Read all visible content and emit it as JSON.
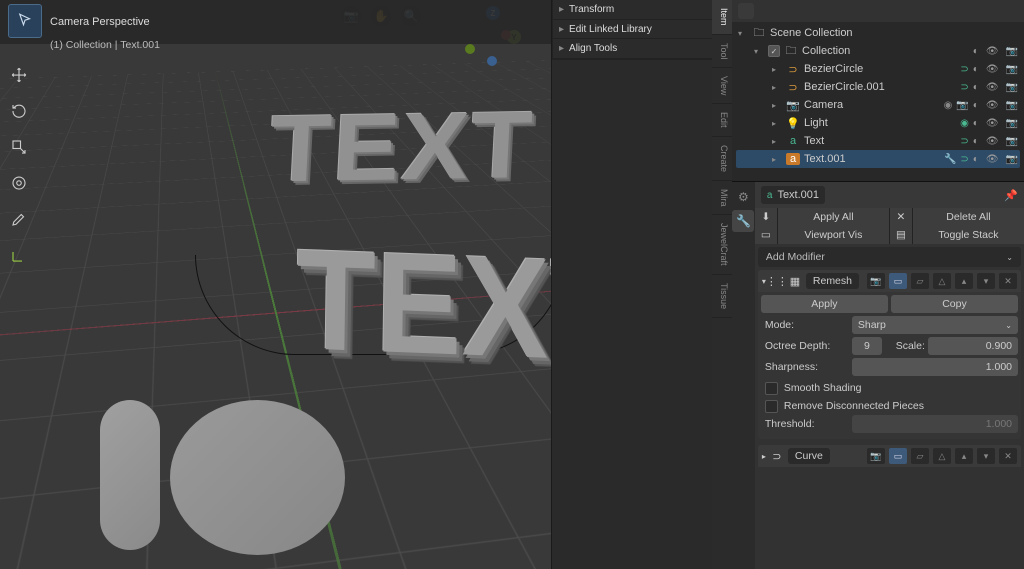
{
  "viewport": {
    "title": "Camera Perspective",
    "subtitle": "(1) Collection | Text.001",
    "text_a": "TEXT",
    "text_b": "TEXT"
  },
  "npanel": {
    "transform": "Transform",
    "edit_linked": "Edit Linked Library",
    "align": "Align Tools",
    "tabs": [
      "Item",
      "Tool",
      "View",
      "Edit",
      "Create",
      "Mira",
      "JewelCraft",
      "Tissue"
    ]
  },
  "outliner": {
    "root": "Scene Collection",
    "collection": "Collection",
    "items": [
      {
        "name": "BezierCircle",
        "type": "curve"
      },
      {
        "name": "BezierCircle.001",
        "type": "curve"
      },
      {
        "name": "Camera",
        "type": "cam"
      },
      {
        "name": "Light",
        "type": "light"
      },
      {
        "name": "Text",
        "type": "text"
      },
      {
        "name": "Text.001",
        "type": "text",
        "selected": true
      }
    ]
  },
  "props": {
    "object_name": "Text.001",
    "apply_all": "Apply All",
    "delete_all": "Delete All",
    "viewport_vis": "Viewport Vis",
    "toggle_stack": "Toggle Stack",
    "add_modifier": "Add Modifier",
    "mod1": {
      "name": "Remesh",
      "apply": "Apply",
      "copy": "Copy",
      "mode_lbl": "Mode:",
      "mode_val": "Sharp",
      "octree_lbl": "Octree Depth:",
      "octree_val": "9",
      "scale_lbl": "Scale:",
      "scale_val": "0.900",
      "sharp_lbl": "Sharpness:",
      "sharp_val": "1.000",
      "smooth": "Smooth Shading",
      "remove": "Remove Disconnected Pieces",
      "thresh_lbl": "Threshold:",
      "thresh_val": "1.000"
    },
    "mod2": {
      "name": "Curve"
    }
  }
}
